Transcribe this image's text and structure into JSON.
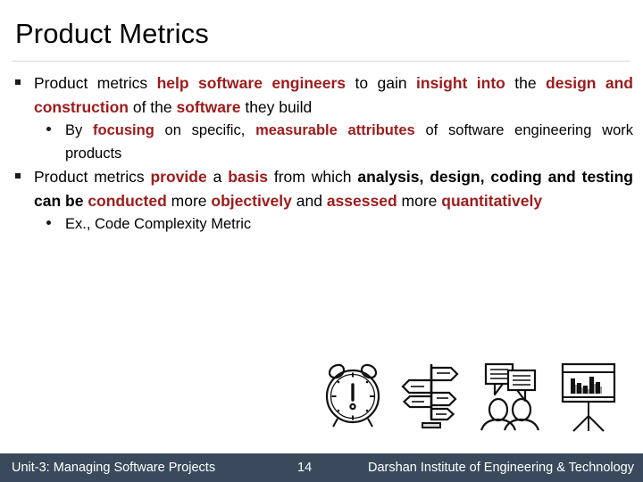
{
  "slide": {
    "title": "Product Metrics",
    "accent_red": "#9e1b1b",
    "footer_bg": "#3a4a5c",
    "divider_color": "#d9d9d9"
  },
  "bullets": [
    {
      "level": 1,
      "marker": "square-bullet",
      "runs": [
        {
          "text": "Product metrics ",
          "style": "normal"
        },
        {
          "text": "help software engineers",
          "style": "red-bold"
        },
        {
          "text": " to gain ",
          "style": "normal"
        },
        {
          "text": "insight into",
          "style": "red-bold"
        },
        {
          "text": " the ",
          "style": "normal"
        },
        {
          "text": "design and construction",
          "style": "red-bold"
        },
        {
          "text": " of the ",
          "style": "normal"
        },
        {
          "text": "software",
          "style": "red-bold"
        },
        {
          "text": " they build",
          "style": "normal"
        }
      ]
    },
    {
      "level": 2,
      "marker": "round-bullet",
      "runs": [
        {
          "text": "By ",
          "style": "normal"
        },
        {
          "text": "focusing",
          "style": "red-bold"
        },
        {
          "text": " on specific, ",
          "style": "normal"
        },
        {
          "text": "measurable attributes",
          "style": "red-bold"
        },
        {
          "text": " of software engineering work products",
          "style": "normal"
        }
      ]
    },
    {
      "level": 1,
      "marker": "square-bullet",
      "runs": [
        {
          "text": "Product metrics ",
          "style": "normal"
        },
        {
          "text": "provide",
          "style": "red-bold"
        },
        {
          "text": " a ",
          "style": "normal"
        },
        {
          "text": "basis",
          "style": "red-bold"
        },
        {
          "text": " from which ",
          "style": "normal"
        },
        {
          "text": "analysis, design, coding and testing can be ",
          "style": "black-bold"
        },
        {
          "text": "conducted",
          "style": "red-bold"
        },
        {
          "text": " more ",
          "style": "normal"
        },
        {
          "text": "objectively",
          "style": "red-bold"
        },
        {
          "text": " and ",
          "style": "normal"
        },
        {
          "text": "assessed",
          "style": "red-bold"
        },
        {
          "text": " more ",
          "style": "normal"
        },
        {
          "text": "quantitatively",
          "style": "red-bold"
        }
      ]
    },
    {
      "level": 2,
      "marker": "round-bullet",
      "runs": [
        {
          "text": "Ex., Code Complexity Metric",
          "style": "normal"
        }
      ]
    }
  ],
  "icons": [
    {
      "name": "alarm-clock-exclamation-icon",
      "label": "alarm clock with exclamation mark"
    },
    {
      "name": "signpost-directions-icon",
      "label": "direction signpost"
    },
    {
      "name": "two-people-conversation-icon",
      "label": "two people with speech bubbles"
    },
    {
      "name": "presentation-bar-chart-icon",
      "label": "presentation board with bar chart"
    }
  ],
  "footer": {
    "left": "Unit-3: Managing Software Projects",
    "page": "14",
    "right": "Darshan Institute of Engineering & Technology"
  }
}
